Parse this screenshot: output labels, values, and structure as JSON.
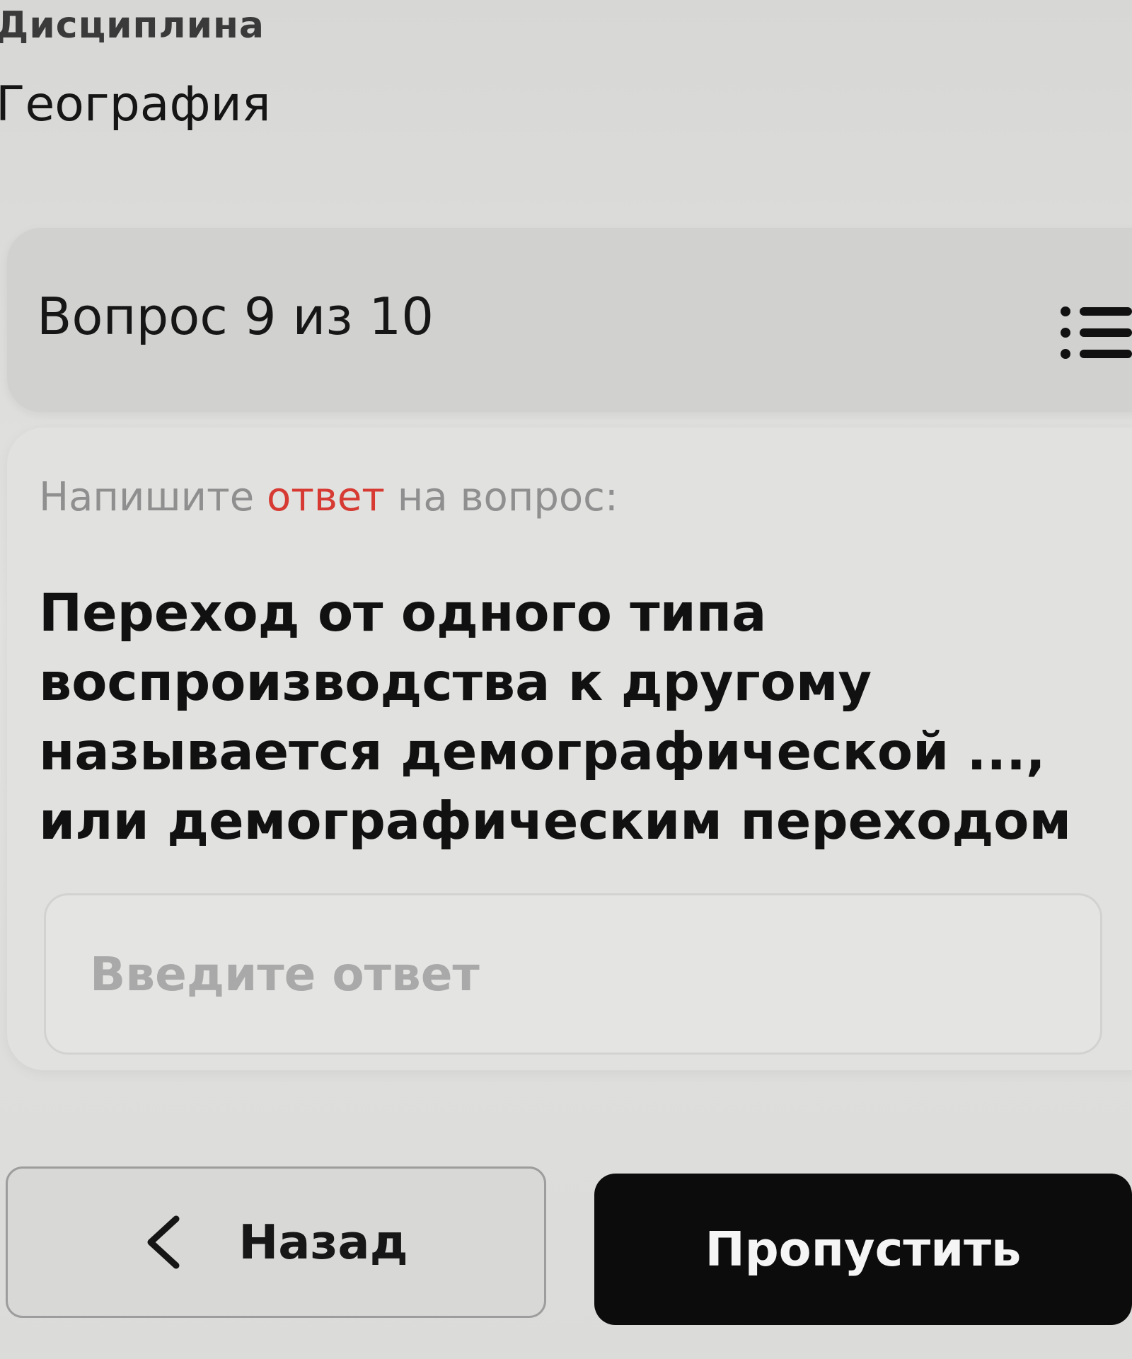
{
  "discipline": {
    "label": "Дисциплина",
    "value": "География"
  },
  "question_header": {
    "counter": "Вопрос 9 из 10",
    "list_icon": "list-icon"
  },
  "question": {
    "instruction_before": "Напишите ",
    "instruction_highlight": "ответ",
    "instruction_after": " на вопрос:",
    "text": "Переход от одного типа воспроизводства к другому называется демографической ..., или демографическим переходом"
  },
  "answer": {
    "value": "",
    "placeholder": "Введите ответ"
  },
  "buttons": {
    "back_label": "Назад",
    "back_icon": "chevron-left-icon",
    "skip_label": "Пропустить"
  },
  "colors": {
    "highlight": "#d63a32",
    "primary_button": "#0c0c0c"
  }
}
